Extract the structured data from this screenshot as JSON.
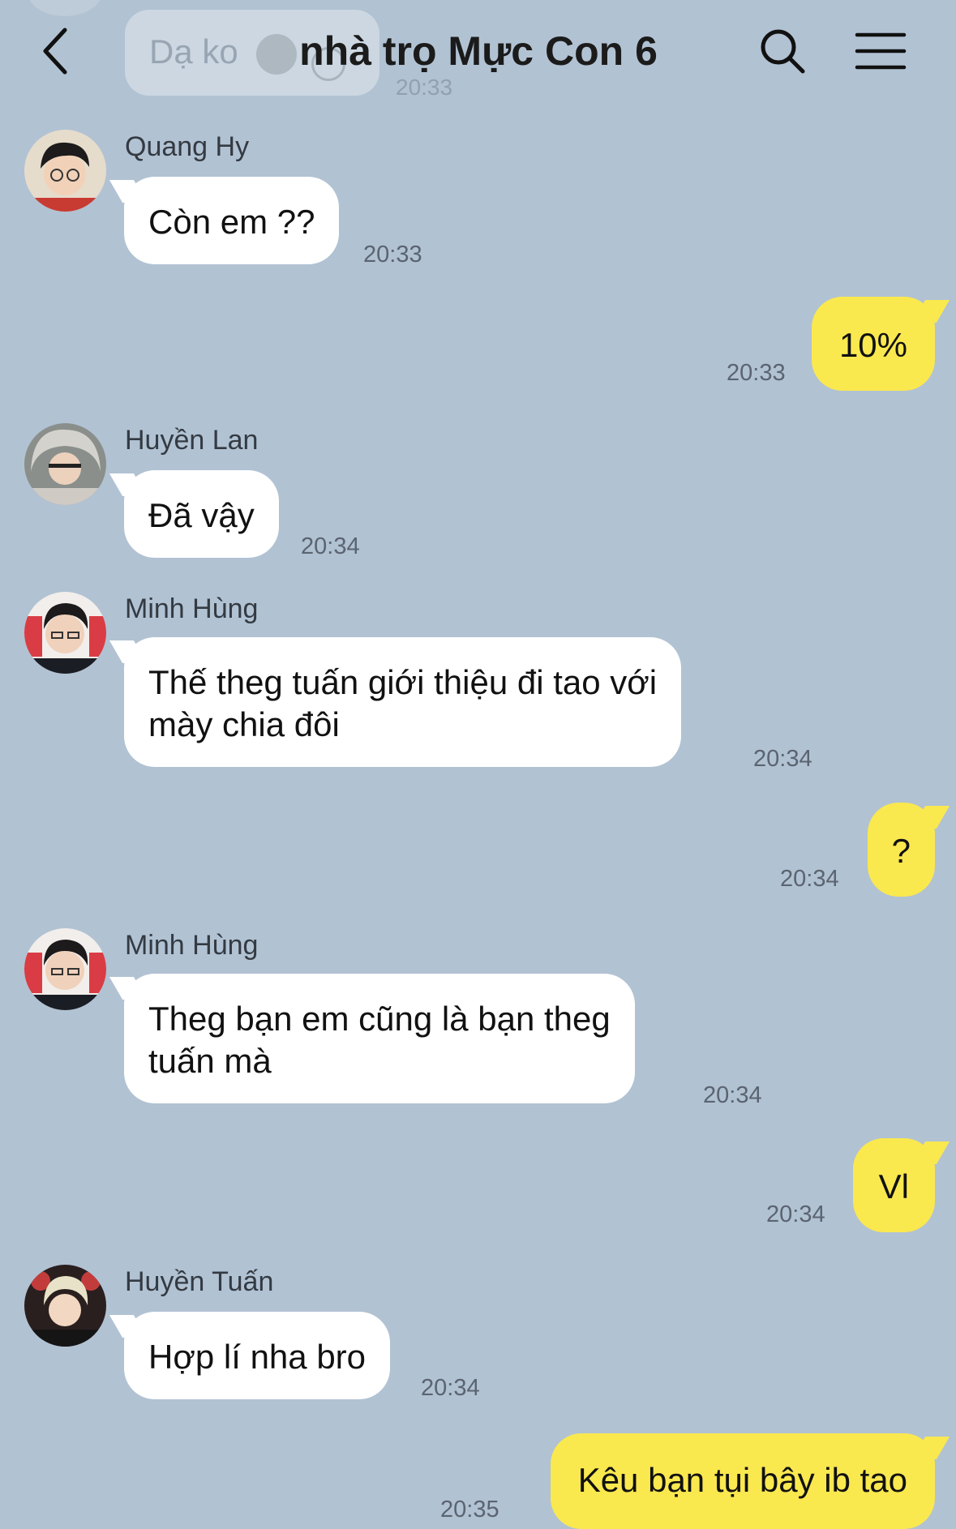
{
  "header": {
    "title": "nhà trọ Mực Con 6"
  },
  "ghost": {
    "text": "Dạ ko",
    "time": "20:33"
  },
  "messages": [
    {
      "sender": "Quang Hy",
      "text": "Còn em ??",
      "time": "20:33"
    },
    {
      "text": "10%",
      "time": "20:33"
    },
    {
      "sender": "Huyền Lan",
      "text": "Đã vậy",
      "time": "20:34"
    },
    {
      "sender": "Minh Hùng",
      "lines": [
        "Thế theg tuấn giới thiệu đi tao với",
        "mày chia đôi"
      ],
      "time": "20:34"
    },
    {
      "text": "?",
      "time": "20:34"
    },
    {
      "sender": "Minh Hùng",
      "lines": [
        "Theg bạn em cũng là bạn theg",
        "tuấn mà"
      ],
      "time": "20:34"
    },
    {
      "text": "Vl",
      "time": "20:34"
    },
    {
      "sender": "Huyền Tuấn",
      "text": "Hợp lí nha bro",
      "time": "20:34"
    },
    {
      "text": "Kêu bạn tụi bây ib tao",
      "time": "20:35"
    }
  ],
  "colors": {
    "background": "#b1c2d3",
    "incoming_bubble": "#ffffff",
    "outgoing_bubble": "#fae84f"
  },
  "icons": [
    "back-arrow-icon",
    "search-icon",
    "menu-icon"
  ]
}
